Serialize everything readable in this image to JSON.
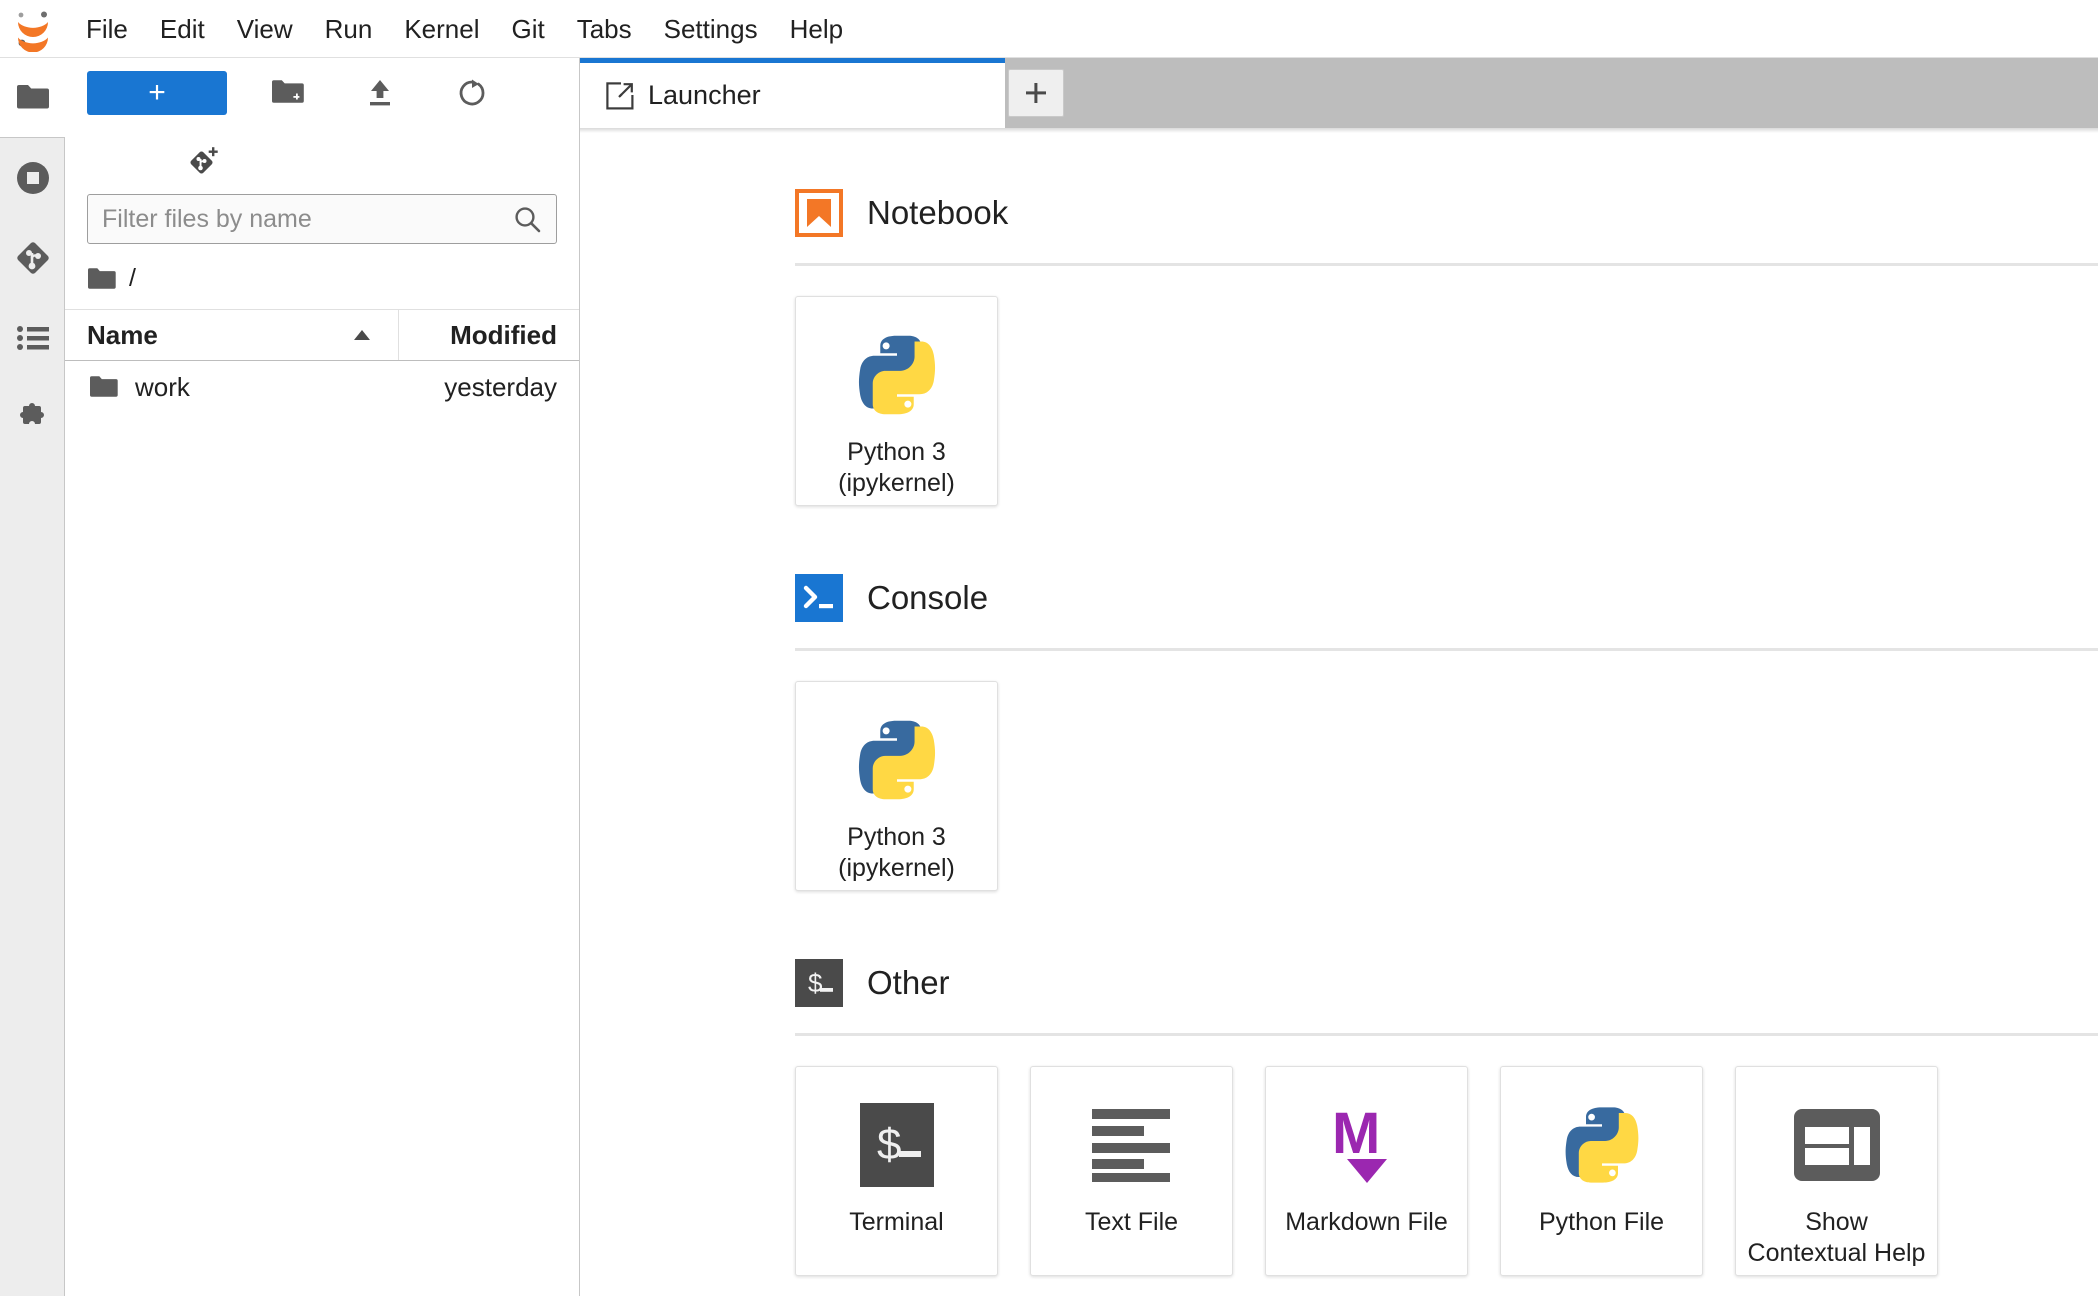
{
  "app": {
    "logo_icon": "jupyter-logo",
    "menu": [
      {
        "label": "File"
      },
      {
        "label": "Edit"
      },
      {
        "label": "View"
      },
      {
        "label": "Run"
      },
      {
        "label": "Kernel"
      },
      {
        "label": "Git"
      },
      {
        "label": "Tabs"
      },
      {
        "label": "Settings"
      },
      {
        "label": "Help"
      }
    ]
  },
  "rail": {
    "items": [
      {
        "name": "file-browser",
        "icon": "folder-icon",
        "active": true
      },
      {
        "name": "running-sessions",
        "icon": "stop-circle-icon",
        "active": false
      },
      {
        "name": "git-panel",
        "icon": "git-icon",
        "active": false
      },
      {
        "name": "table-of-contents",
        "icon": "list-bullets-icon",
        "active": false
      },
      {
        "name": "extension-manager",
        "icon": "puzzle-icon",
        "active": false
      }
    ]
  },
  "browser": {
    "toolbar": {
      "new_launcher_label": "+",
      "new_folder_icon": "new-folder-icon",
      "upload_icon": "upload-icon",
      "refresh_icon": "refresh-icon",
      "git_clone_icon": "git-clone-icon"
    },
    "filter": {
      "placeholder": "Filter files by name",
      "value": "",
      "icon": "search-icon"
    },
    "breadcrumb": {
      "root_icon": "folder-icon",
      "path": "/"
    },
    "columns": {
      "name": "Name",
      "modified": "Modified",
      "sort_icon": "sort-ascending-caret"
    },
    "files": [
      {
        "name": "work",
        "modified": "yesterday",
        "icon": "folder-icon"
      }
    ]
  },
  "tabbar": {
    "tabs": [
      {
        "label": "Launcher",
        "icon": "launcher-icon",
        "active": true
      }
    ],
    "new_tab_label": "+"
  },
  "launcher": {
    "sections": [
      {
        "key": "notebook",
        "title": "Notebook",
        "icon": "jupyter-notebook-icon",
        "cards": [
          {
            "label": "Python 3\n(ipykernel)",
            "line1": "Python 3",
            "line2": "(ipykernel)",
            "icon": "python-logo-icon"
          }
        ]
      },
      {
        "key": "console",
        "title": "Console",
        "icon": "console-prompt-icon",
        "cards": [
          {
            "label": "Python 3\n(ipykernel)",
            "line1": "Python 3",
            "line2": "(ipykernel)",
            "icon": "python-logo-icon"
          }
        ]
      },
      {
        "key": "other",
        "title": "Other",
        "icon": "terminal-dollar-icon",
        "cards": [
          {
            "label": "Terminal",
            "line1": "Terminal",
            "line2": "",
            "icon": "terminal-dollar-icon"
          },
          {
            "label": "Text File",
            "line1": "Text File",
            "line2": "",
            "icon": "text-lines-icon"
          },
          {
            "label": "Markdown File",
            "line1": "Markdown File",
            "line2": "",
            "icon": "markdown-icon"
          },
          {
            "label": "Python File",
            "line1": "Python File",
            "line2": "",
            "icon": "python-logo-icon"
          },
          {
            "label": "Show Contextual Help",
            "line1": "Show",
            "line2": "Contextual Help",
            "icon": "contextual-help-icon"
          }
        ]
      }
    ]
  },
  "colors": {
    "accent_blue": "#1976d2",
    "jupyter_orange": "#f37726",
    "markdown_purple": "#9b27b0",
    "python_blue": "#386a9f",
    "python_yellow": "#ffd844",
    "terminal_dark": "#4a4a4a",
    "tabbar_gray": "#bdbdbd",
    "rail_gray": "#ededed"
  }
}
